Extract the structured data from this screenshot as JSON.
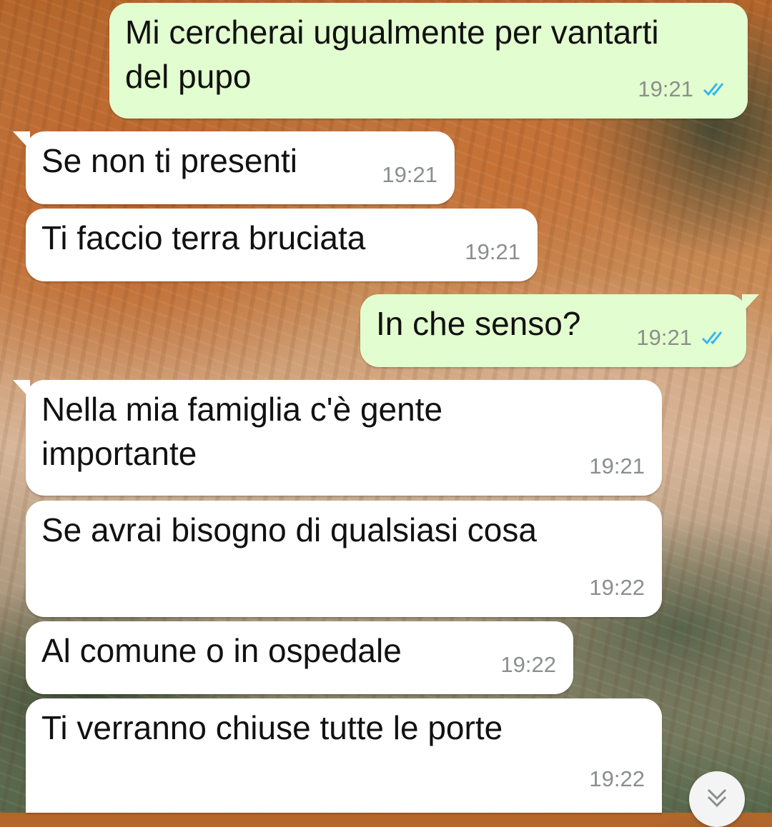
{
  "messages": [
    {
      "text": "Mi cercherai ugualmente per vantarti\ndel pupo",
      "time": "19:21",
      "direction": "outgoing",
      "read": true
    },
    {
      "text": "Se non ti presenti",
      "time": "19:21",
      "direction": "incoming"
    },
    {
      "text": "Ti faccio terra bruciata",
      "time": "19:21",
      "direction": "incoming"
    },
    {
      "text": "In che senso?",
      "time": "19:21",
      "direction": "outgoing",
      "read": true
    },
    {
      "text": "Nella mia famiglia c'è gente\nimportante",
      "time": "19:21",
      "direction": "incoming"
    },
    {
      "text": "Se avrai bisogno di qualsiasi cosa",
      "time": "19:22",
      "direction": "incoming"
    },
    {
      "text": "Al comune o in ospedale",
      "time": "19:22",
      "direction": "incoming"
    },
    {
      "text": "Ti verranno chiuse tutte le porte",
      "time": "19:22",
      "direction": "incoming"
    }
  ],
  "icons": {
    "read_receipt": "double-check-icon",
    "scroll_down": "chevron-double-down-icon"
  },
  "colors": {
    "incoming_bubble": "#ffffff",
    "outgoing_bubble": "#e2fdcf",
    "read_tick": "#34b7f1",
    "timestamp": "#8b8f8c"
  }
}
